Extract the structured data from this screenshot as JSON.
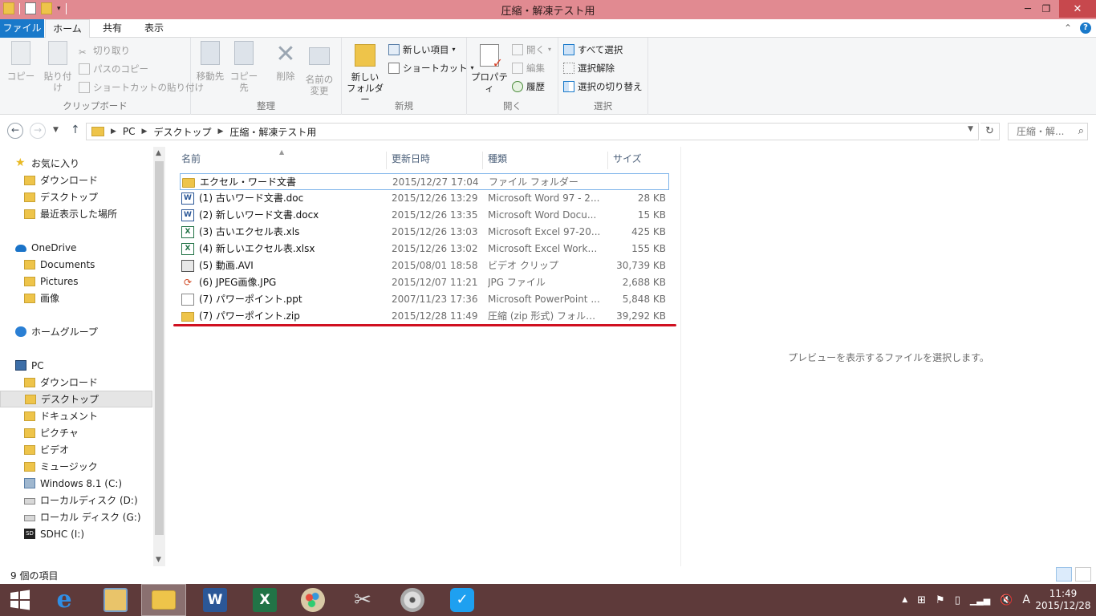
{
  "window": {
    "title": "圧縮・解凍テスト用",
    "controls": {
      "minimize": "─",
      "maximize": "❐",
      "close": "✕"
    }
  },
  "ribbon_tabs": [
    "ファイル",
    "ホーム",
    "共有",
    "表示"
  ],
  "ribbon": {
    "clipboard": {
      "label": "クリップボード",
      "copy": "コピー",
      "paste": "貼り付け",
      "cut": "切り取り",
      "copy_path": "パスのコピー",
      "paste_shortcut": "ショートカットの貼り付け"
    },
    "organize": {
      "label": "整理",
      "move_to": "移動先",
      "copy_to": "コピー先",
      "delete": "削除",
      "rename_1": "名前の",
      "rename_2": "変更"
    },
    "new": {
      "label": "新規",
      "new_folder_1": "新しい",
      "new_folder_2": "フォルダー",
      "new_item": "新しい項目",
      "shortcut": "ショートカット"
    },
    "open": {
      "label": "開く",
      "properties": "プロパティ",
      "open": "開く",
      "edit": "編集",
      "history": "履歴"
    },
    "select": {
      "label": "選択",
      "select_all": "すべて選択",
      "select_none": "選択解除",
      "invert": "選択の切り替え"
    }
  },
  "address": {
    "crumbs": [
      "PC",
      "デスクトップ",
      "圧縮・解凍テスト用"
    ],
    "search_placeholder": "圧縮・解..."
  },
  "nav_pane": [
    {
      "label": "お気に入り",
      "icon": "star-icon",
      "indent": 0
    },
    {
      "label": "ダウンロード",
      "icon": "download-folder-icon",
      "indent": 1
    },
    {
      "label": "デスクトップ",
      "icon": "desktop-folder-icon",
      "indent": 1
    },
    {
      "label": "最近表示した場所",
      "icon": "recent-places-icon",
      "indent": 1
    },
    {
      "label": "OneDrive",
      "icon": "cloud-icon",
      "indent": 0
    },
    {
      "label": "Documents",
      "icon": "folder-icon",
      "indent": 1
    },
    {
      "label": "Pictures",
      "icon": "folder-icon",
      "indent": 1
    },
    {
      "label": "画像",
      "icon": "folder-icon",
      "indent": 1
    },
    {
      "label": "ホームグループ",
      "icon": "homegroup-icon",
      "indent": 0
    },
    {
      "label": "PC",
      "icon": "computer-icon",
      "indent": 0
    },
    {
      "label": "ダウンロード",
      "icon": "download-folder-icon",
      "indent": 1
    },
    {
      "label": "デスクトップ",
      "icon": "desktop-folder-icon",
      "indent": 1,
      "selected": true
    },
    {
      "label": "ドキュメント",
      "icon": "documents-folder-icon",
      "indent": 1
    },
    {
      "label": "ピクチャ",
      "icon": "pictures-folder-icon",
      "indent": 1
    },
    {
      "label": "ビデオ",
      "icon": "videos-folder-icon",
      "indent": 1
    },
    {
      "label": "ミュージック",
      "icon": "music-folder-icon",
      "indent": 1
    },
    {
      "label": "Windows 8.1 (C:)",
      "icon": "system-drive-icon",
      "indent": 1
    },
    {
      "label": "ローカルディスク (D:)",
      "icon": "drive-icon",
      "indent": 1
    },
    {
      "label": "ローカル ディスク (G:)",
      "icon": "drive-icon",
      "indent": 1
    },
    {
      "label": "SDHC (I:)",
      "icon": "sd-card-icon",
      "indent": 1
    }
  ],
  "columns": [
    "名前",
    "更新日時",
    "種類",
    "サイズ"
  ],
  "files": [
    {
      "name": "エクセル・ワード文書",
      "date": "2015/12/27 17:04",
      "type": "ファイル フォルダー",
      "size": "",
      "icon": "folder-icon"
    },
    {
      "name": "(1) 古いワード文書.doc",
      "date": "2015/12/26 13:29",
      "type": "Microsoft Word 97 - 2...",
      "size": "28 KB",
      "icon": "word-file-icon"
    },
    {
      "name": "(2) 新しいワード文書.docx",
      "date": "2015/12/26 13:35",
      "type": "Microsoft Word Docu...",
      "size": "15 KB",
      "icon": "word-file-icon"
    },
    {
      "name": "(3) 古いエクセル表.xls",
      "date": "2015/12/26 13:03",
      "type": "Microsoft Excel 97-20...",
      "size": "425 KB",
      "icon": "excel-file-icon"
    },
    {
      "name": "(4) 新しいエクセル表.xlsx",
      "date": "2015/12/26 13:02",
      "type": "Microsoft Excel Works...",
      "size": "155 KB",
      "icon": "excel-file-icon"
    },
    {
      "name": "(5) 動画.AVI",
      "date": "2015/08/01 18:58",
      "type": "ビデオ クリップ",
      "size": "30,739 KB",
      "icon": "video-file-icon"
    },
    {
      "name": "(6)  JPEG画像.JPG",
      "date": "2015/12/07 11:21",
      "type": "JPG ファイル",
      "size": "2,688 KB",
      "icon": "image-file-icon"
    },
    {
      "name": "(7) パワーポイント.ppt",
      "date": "2007/11/23 17:36",
      "type": "Microsoft PowerPoint ...",
      "size": "5,848 KB",
      "icon": "powerpoint-file-icon"
    },
    {
      "name": "(7) パワーポイント.zip",
      "date": "2015/12/28 11:49",
      "type": "圧縮 (zip 形式) フォルダー",
      "size": "39,292 KB",
      "icon": "zip-folder-icon"
    }
  ],
  "preview_message": "プレビューを表示するファイルを選択します。",
  "status": {
    "item_count": "9 個の項目"
  },
  "taskbar": {
    "apps": [
      "start",
      "internet-explorer",
      "file-manager",
      "file-explorer",
      "word",
      "excel",
      "paint",
      "snipping-tool",
      "media-player",
      "chat-app"
    ],
    "ime": "A",
    "time": "11:49",
    "date": "2015/12/28"
  },
  "colors": {
    "accent": "#1979ca",
    "title_bar": "#e18a91",
    "taskbar": "#5e3a3a",
    "highlight_underline": "#d01020"
  }
}
